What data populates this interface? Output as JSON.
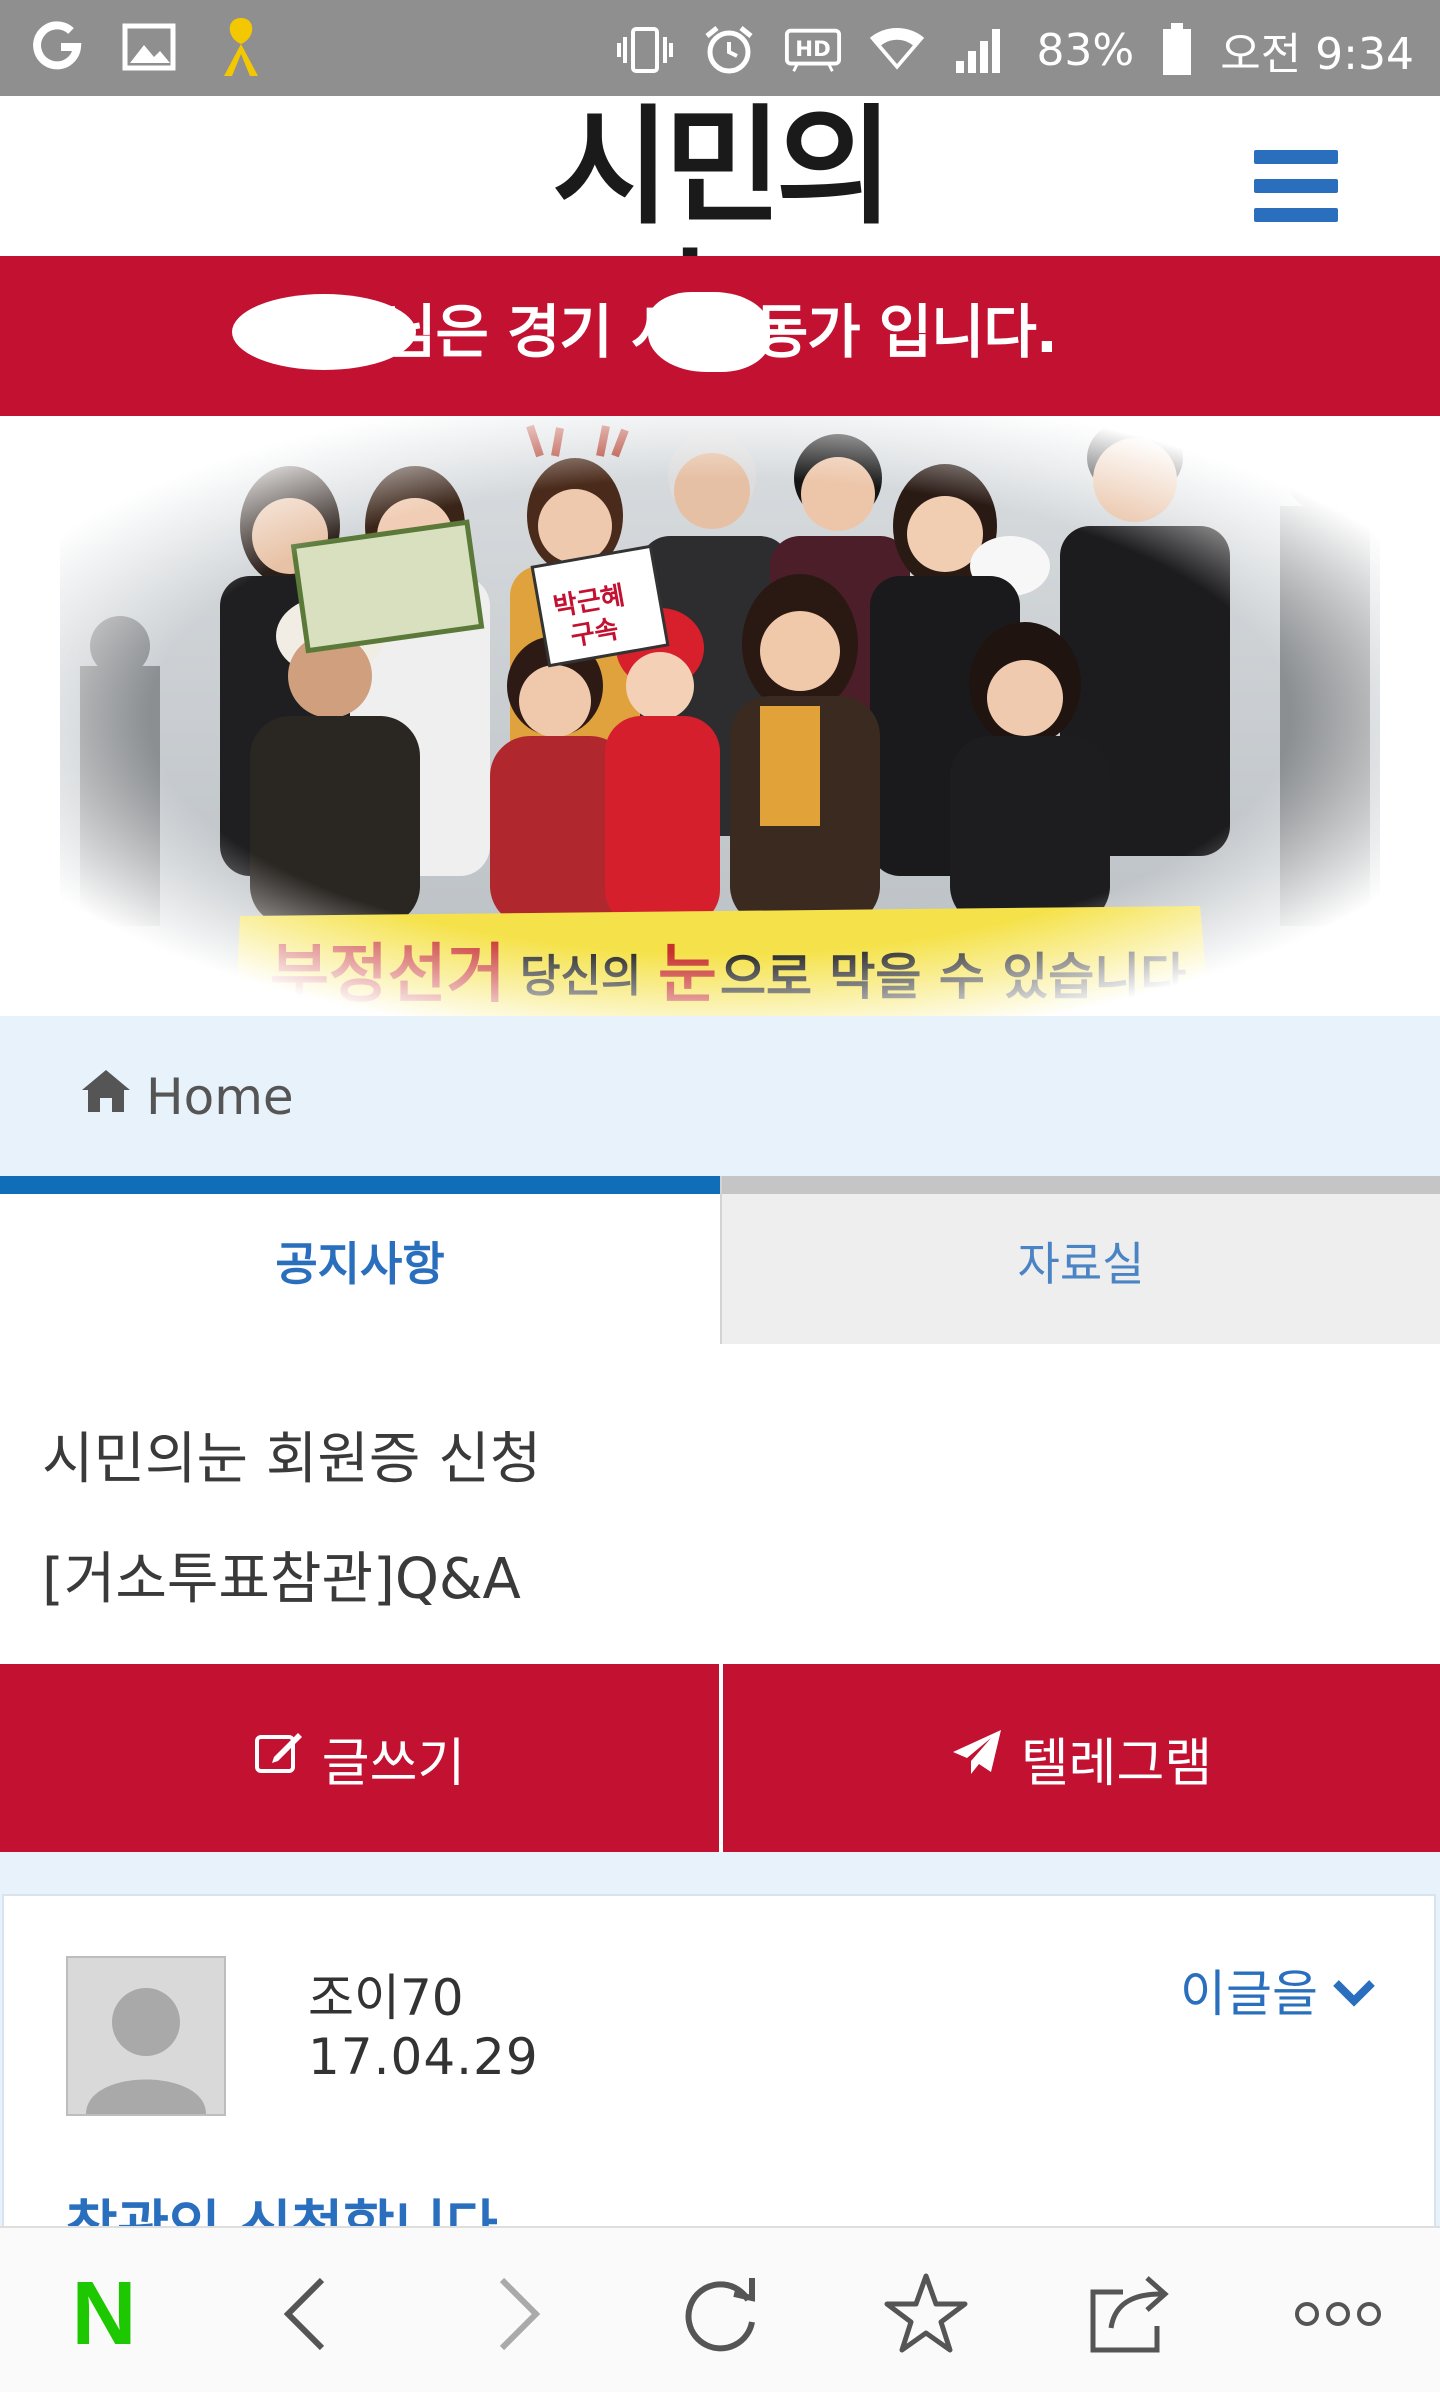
{
  "status_bar": {
    "battery": "83%",
    "time": "오전 9:34",
    "left_icons": [
      "notification-icon",
      "gallery-icon",
      "yellow-ribbon-icon"
    ],
    "right_icons": [
      "vibrate-icon",
      "alarm-icon",
      "hd-icon",
      "wifi-icon",
      "signal-icon",
      "battery-icon"
    ]
  },
  "header": {
    "logo": "시민의 눈",
    "menu_icon": "hamburger-menu-icon"
  },
  "banner": {
    "text": "님은 경기 시 활동가 입니다."
  },
  "hero": {
    "banner_text_main": "부정선거",
    "banner_text_mid": "당신의",
    "banner_text_eye": "눈",
    "banner_text_end": "으로 막을 수 있습니다",
    "sign_text": "박근혜 구속"
  },
  "breadcrumb": {
    "icon": "home-icon",
    "label": "Home"
  },
  "tabs": [
    {
      "label": "공지사항",
      "active": true
    },
    {
      "label": "자료실",
      "active": false
    }
  ],
  "notices": [
    "시민의눈 회원증 신청",
    "[거소투표참관]Q&A"
  ],
  "actions": {
    "write_label": "글쓰기",
    "write_icon": "edit-icon",
    "telegram_label": "텔레그램",
    "telegram_icon": "paper-plane-icon"
  },
  "post": {
    "author": "조이70",
    "date": "17.04.29",
    "more_label": "이글을",
    "more_icon": "chevron-down-icon",
    "title": "참관인 신청합니다"
  },
  "browser_bar": {
    "buttons": [
      "naver-icon",
      "back-icon",
      "forward-icon",
      "refresh-icon",
      "bookmark-star-icon",
      "share-icon",
      "more-dots-icon"
    ],
    "naver_label": "N"
  },
  "colors": {
    "accent_red": "#c21131",
    "accent_blue": "#2a6fbd",
    "status_bar": "#8f8f8f",
    "breadcrumb_bg": "#e7f2fb"
  }
}
